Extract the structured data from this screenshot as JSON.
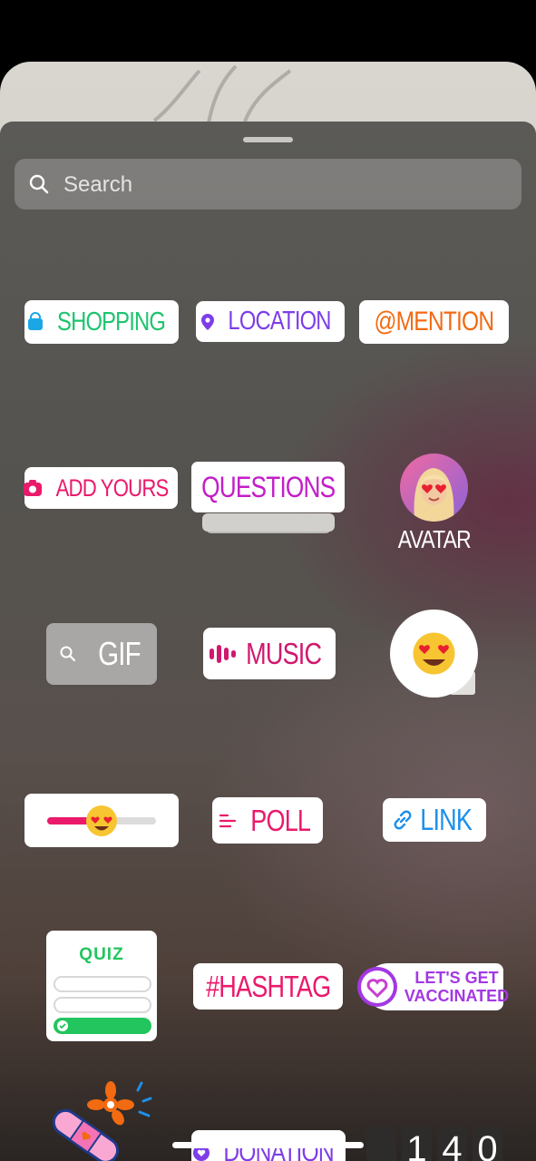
{
  "search": {
    "placeholder": "Search"
  },
  "stickers": {
    "shopping": "SHOPPING",
    "location": "LOCATION",
    "mention": "@MENTION",
    "add_yours": "ADD YOURS",
    "questions": "QUESTIONS",
    "avatar": "AVATAR",
    "gif": "GIF",
    "music": "MUSIC",
    "emoji_slider": {
      "value": 0.5
    },
    "poll": "POLL",
    "link": "LINK",
    "quiz": "QUIZ",
    "hashtag": "#HASHTAG",
    "vaccinated_line1": "LET'S GET",
    "vaccinated_line2": "VACCINATED",
    "donation": "DONATION",
    "countdown_digits": [
      "",
      "1",
      "4",
      "0"
    ]
  },
  "colors": {
    "shopping": "#1ec46f",
    "location": "#7d3ee8",
    "mention": "#f26a12",
    "pink": "#ea1a6b",
    "questions": "#c21ec8",
    "link": "#1d8fea",
    "quiz_green": "#22c55e",
    "vaccinated": "#a338e2"
  }
}
